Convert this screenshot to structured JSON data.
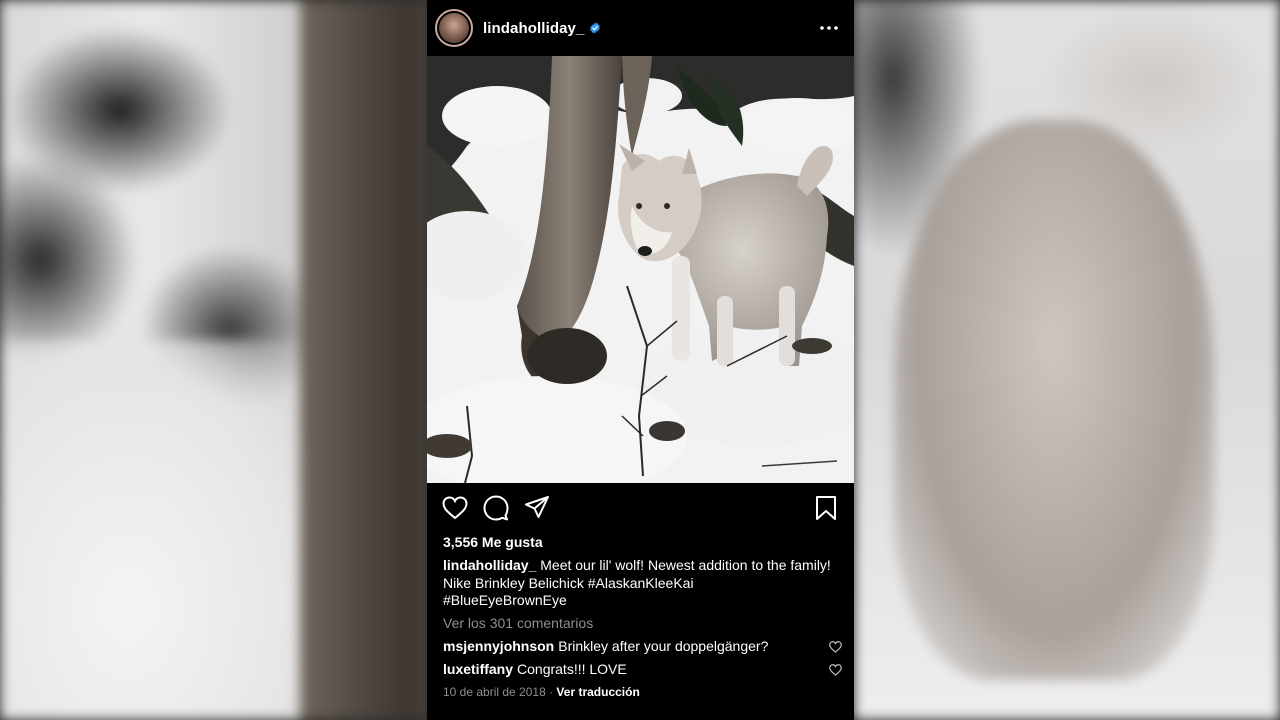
{
  "post": {
    "username": "lindaholliday_",
    "verified": true,
    "likes": "3,556 Me gusta",
    "caption": {
      "username": "lindaholliday_",
      "text": "Meet our lil' wolf! Newest addition to the family!",
      "line2": "Nike Brinkley Belichick #AlaskanKleeKai",
      "line3": "#BlueEyeBrownEye"
    },
    "view_comments": "Ver los 301 comentarios",
    "comments": [
      {
        "username": "msjennyjohnson",
        "text": "Brinkley after your doppelgänger?"
      },
      {
        "username": "luxetiffany",
        "text": "Congrats!!! LOVE"
      }
    ],
    "date": "10 de abril de 2018",
    "separator": " · ",
    "translate": "Ver traducción"
  },
  "icons": {
    "verified": "verified-badge-icon",
    "more": "more-options-icon",
    "like": "heart-icon",
    "comment": "comment-bubble-icon",
    "share": "paper-plane-icon",
    "save": "bookmark-icon"
  },
  "colors": {
    "background": "#000000",
    "verified_blue": "#3897f0",
    "muted_text": "#8e8e8e"
  }
}
